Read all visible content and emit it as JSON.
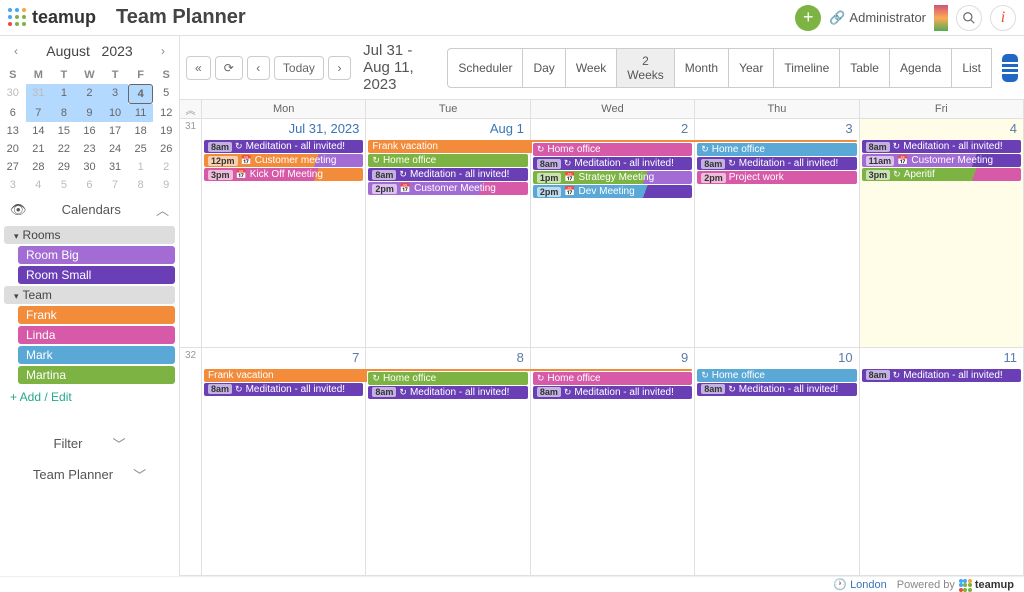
{
  "header": {
    "logo_text": "teamup",
    "app_title": "Team Planner",
    "admin_label": "Administrator"
  },
  "mini_calendar": {
    "month": "August",
    "year": "2023",
    "dow": [
      "S",
      "M",
      "T",
      "W",
      "T",
      "F",
      "S"
    ],
    "weeks": [
      [
        {
          "d": "30",
          "dim": true
        },
        {
          "d": "31",
          "dim": true,
          "range": true
        },
        {
          "d": "1",
          "range": true
        },
        {
          "d": "2",
          "range": true
        },
        {
          "d": "3",
          "range": true
        },
        {
          "d": "4",
          "range": true,
          "today": true
        },
        {
          "d": "5"
        }
      ],
      [
        {
          "d": "6"
        },
        {
          "d": "7",
          "range": true
        },
        {
          "d": "8",
          "range": true
        },
        {
          "d": "9",
          "range": true
        },
        {
          "d": "10",
          "range": true
        },
        {
          "d": "11",
          "range": true
        },
        {
          "d": "12"
        }
      ],
      [
        {
          "d": "13"
        },
        {
          "d": "14"
        },
        {
          "d": "15"
        },
        {
          "d": "16"
        },
        {
          "d": "17"
        },
        {
          "d": "18"
        },
        {
          "d": "19"
        }
      ],
      [
        {
          "d": "20"
        },
        {
          "d": "21"
        },
        {
          "d": "22"
        },
        {
          "d": "23"
        },
        {
          "d": "24"
        },
        {
          "d": "25"
        },
        {
          "d": "26"
        }
      ],
      [
        {
          "d": "27"
        },
        {
          "d": "28"
        },
        {
          "d": "29"
        },
        {
          "d": "30"
        },
        {
          "d": "31"
        },
        {
          "d": "1",
          "dim": true
        },
        {
          "d": "2",
          "dim": true
        }
      ],
      [
        {
          "d": "3",
          "dim": true
        },
        {
          "d": "4",
          "dim": true
        },
        {
          "d": "5",
          "dim": true
        },
        {
          "d": "6",
          "dim": true
        },
        {
          "d": "7",
          "dim": true
        },
        {
          "d": "8",
          "dim": true
        },
        {
          "d": "9",
          "dim": true
        }
      ]
    ]
  },
  "sidebar": {
    "calendars_label": "Calendars",
    "groups": [
      {
        "name": "Rooms",
        "items": [
          {
            "label": "Room Big",
            "color": "#a26cd4"
          },
          {
            "label": "Room Small",
            "color": "#6a3fb5"
          }
        ]
      },
      {
        "name": "Team",
        "items": [
          {
            "label": "Frank",
            "color": "#f28c3b"
          },
          {
            "label": "Linda",
            "color": "#d65aa8"
          },
          {
            "label": "Mark",
            "color": "#5aa8d6"
          },
          {
            "label": "Martina",
            "color": "#7cb342"
          }
        ]
      }
    ],
    "add_edit": "+ Add / Edit",
    "filter_label": "Filter",
    "planner_label": "Team Planner"
  },
  "toolbar": {
    "today": "Today",
    "date_range": "Jul 31 - Aug 11, 2023",
    "views": [
      "Scheduler",
      "Day",
      "Week",
      "2 Weeks",
      "Month",
      "Year",
      "Timeline",
      "Table",
      "Agenda",
      "List"
    ],
    "active_view": "2 Weeks"
  },
  "calendar": {
    "dow": [
      "Mon",
      "Tue",
      "Wed",
      "Thu",
      "Fri"
    ],
    "weeks": [
      {
        "num": "31",
        "days": [
          {
            "label": "Jul 31, 2023",
            "first": true,
            "events": [
              {
                "time": "8am",
                "icon": "↻",
                "title": "Meditation - all invited!",
                "color": "#6a3fb5"
              },
              {
                "time": "12pm",
                "icon": "📅",
                "title": "Customer meeting",
                "color": "#f28c3b",
                "stripe": "#a26cd4"
              },
              {
                "time": "3pm",
                "icon": "📅",
                "title": "Kick Off Meeting",
                "color": "#d65aa8",
                "stripe": "#f28c3b"
              }
            ]
          },
          {
            "label": "Aug 1",
            "first": true,
            "events": [
              {
                "title": "Frank vacation",
                "color": "#f28c3b",
                "span": "start"
              },
              {
                "icon": "↻",
                "title": "Home office",
                "color": "#7cb342"
              },
              {
                "time": "8am",
                "icon": "↻",
                "title": "Meditation - all invited!",
                "color": "#6a3fb5"
              },
              {
                "time": "2pm",
                "icon": "📅",
                "title": "Customer Meeting",
                "color": "#a26cd4",
                "stripe": "#d65aa8"
              }
            ]
          },
          {
            "label": "2",
            "events": [
              {
                "title": "",
                "color": "#f28c3b",
                "span": "mid"
              },
              {
                "icon": "↻",
                "title": "Home office",
                "color": "#d65aa8"
              },
              {
                "time": "8am",
                "icon": "↻",
                "title": "Meditation - all invited!",
                "color": "#6a3fb5"
              },
              {
                "time": "1pm",
                "icon": "📅",
                "title": "Strategy Meeting",
                "color": "#7cb342",
                "stripe": "#a26cd4"
              },
              {
                "time": "2pm",
                "icon": "📅",
                "title": "Dev Meeting",
                "color": "#5aa8d6",
                "stripe": "#6a3fb5"
              }
            ]
          },
          {
            "label": "3",
            "events": [
              {
                "title": "",
                "color": "#f28c3b",
                "span": "end"
              },
              {
                "icon": "↻",
                "title": "Home office",
                "color": "#5aa8d6"
              },
              {
                "time": "8am",
                "icon": "↻",
                "title": "Meditation - all invited!",
                "color": "#6a3fb5"
              },
              {
                "time": "2pm",
                "title": "Project work",
                "color": "#d65aa8"
              }
            ]
          },
          {
            "label": "4",
            "today": true,
            "events": [
              {
                "time": "8am",
                "icon": "↻",
                "title": "Meditation - all invited!",
                "color": "#6a3fb5"
              },
              {
                "time": "11am",
                "icon": "📅",
                "title": "Customer Meeting",
                "color": "#a26cd4",
                "stripe": "#6a3fb5"
              },
              {
                "time": "3pm",
                "icon": "↻",
                "title": "Aperitif",
                "color": "#7cb342",
                "stripe": "#d65aa8"
              }
            ]
          }
        ]
      },
      {
        "num": "32",
        "days": [
          {
            "label": "7",
            "events": [
              {
                "title": "Frank vacation",
                "color": "#f28c3b",
                "span": "start"
              },
              {
                "time": "8am",
                "icon": "↻",
                "title": "Meditation - all invited!",
                "color": "#6a3fb5"
              }
            ]
          },
          {
            "label": "8",
            "events": [
              {
                "title": "",
                "color": "#f28c3b",
                "span": "mid"
              },
              {
                "icon": "↻",
                "title": "Home office",
                "color": "#7cb342"
              },
              {
                "time": "8am",
                "icon": "↻",
                "title": "Meditation - all invited!",
                "color": "#6a3fb5"
              }
            ]
          },
          {
            "label": "9",
            "events": [
              {
                "title": "",
                "color": "#f28c3b",
                "span": "end"
              },
              {
                "icon": "↻",
                "title": "Home office",
                "color": "#d65aa8"
              },
              {
                "time": "8am",
                "icon": "↻",
                "title": "Meditation - all invited!",
                "color": "#6a3fb5"
              }
            ]
          },
          {
            "label": "10",
            "events": [
              {
                "icon": "↻",
                "title": "Home office",
                "color": "#5aa8d6"
              },
              {
                "time": "8am",
                "icon": "↻",
                "title": "Meditation - all invited!",
                "color": "#6a3fb5"
              }
            ]
          },
          {
            "label": "11",
            "events": [
              {
                "time": "8am",
                "icon": "↻",
                "title": "Meditation - all invited!",
                "color": "#6a3fb5"
              }
            ]
          }
        ]
      }
    ]
  },
  "footer": {
    "tz": "London",
    "powered": "Powered by",
    "brand": "teamup"
  },
  "colors": {
    "logo": [
      "#34a",
      "#3a5",
      "#e33",
      "#e93"
    ]
  }
}
